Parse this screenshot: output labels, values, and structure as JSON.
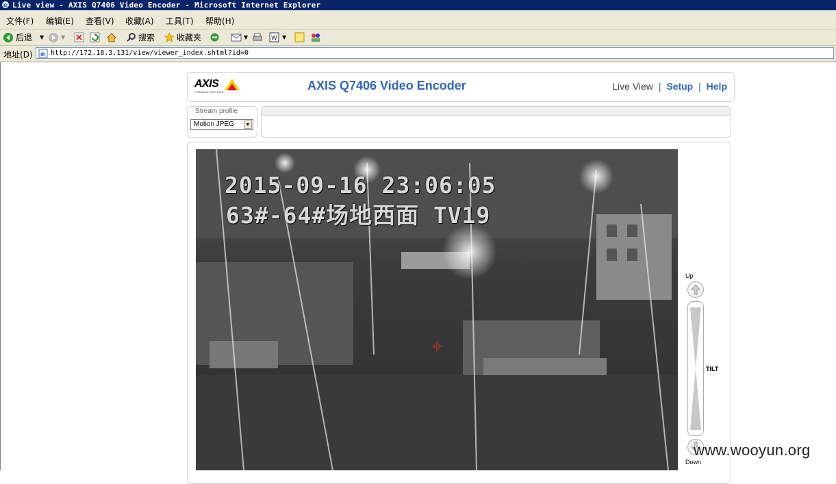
{
  "window": {
    "title": "Live view - AXIS Q7406 Video Encoder - Microsoft Internet Explorer"
  },
  "menu": [
    "文件(F)",
    "编辑(E)",
    "查看(V)",
    "收藏(A)",
    "工具(T)",
    "帮助(H)"
  ],
  "toolbar": {
    "back_label": "后退",
    "search_label": "搜索",
    "favorites_label": "收藏夹"
  },
  "address": {
    "label": "地址(D)",
    "url": "http://172.18.3.131/view/viewer_index.shtml?id=0"
  },
  "page": {
    "logo_text": "AXIS",
    "logo_sub": "COMMUNICATIONS",
    "title": "AXIS Q7406 Video Encoder",
    "nav": {
      "live_view": "Live View",
      "setup": "Setup",
      "help": "Help",
      "separator": "|"
    },
    "stream_profile": {
      "label": "Stream profile",
      "value": "Motion JPEG"
    }
  },
  "video": {
    "osd_line1": "2015-09-16 23:06:05",
    "osd_line2": "63#-64#场地西面  TV19"
  },
  "ptz": {
    "up_label": "Up",
    "down_label": "Down",
    "tilt_label": "TILT"
  },
  "watermark": "www.wooyun.org"
}
